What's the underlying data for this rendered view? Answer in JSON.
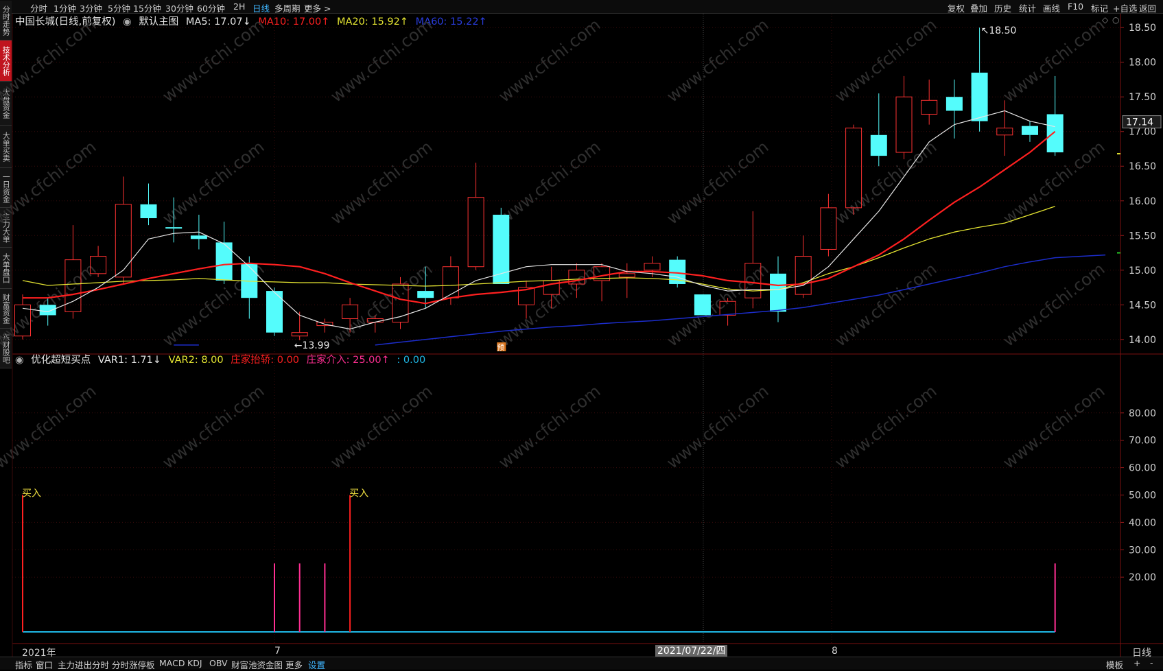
{
  "topbar": {
    "left_items": [
      "分时",
      "1分钟",
      "3分钟",
      "5分钟",
      "15分钟",
      "30分钟",
      "60分钟",
      "2H",
      "日线",
      "多周期",
      "更多 >"
    ],
    "active": "日线",
    "right_items": [
      "复权",
      "叠加",
      "历史",
      "统计",
      "画线",
      "F10",
      "标记",
      "+自选",
      "返回"
    ]
  },
  "sidebar": [
    "分时走势",
    "技术分析",
    "大盘资金",
    "大单买卖",
    "一日资金",
    "主力大单",
    "大单盘口",
    "财富资金",
    "东财股吧"
  ],
  "sidebar_active": 1,
  "main_legend": {
    "name": "中国长城(日线,前复权)",
    "template": "默认主图",
    "ma5": "MA5: 17.07↓",
    "ma10": "MA10: 17.00↑",
    "ma20": "MA20: 15.92↑",
    "ma60": "MA60: 15.22↑"
  },
  "sub_legend": {
    "name": "优化超短买点",
    "var1": "VAR1: 1.71↓",
    "var2": "VAR2: 8.00",
    "lift": "庄家抬轿: 0.00",
    "enter": "庄家介入: 25.00↑",
    "blank": ": 0.00"
  },
  "labels": {
    "high": "18.50",
    "low": "13.99",
    "current_price": "17.14",
    "pre_marker": "预",
    "buy": "买入",
    "watermark": "www.cfchi.com",
    "period": "日线"
  },
  "date_axis": {
    "year": "2021年",
    "month7": "7",
    "cursor_date": "2021/07/22/四",
    "month8": "8"
  },
  "bottombar": {
    "items": [
      "指标",
      "窗口",
      "主力进出分时",
      "分时涨停板",
      "MACD",
      "KDJ",
      "OBV",
      "财富池资金图",
      "更多",
      "设置"
    ],
    "active": "设置",
    "right_items": [
      "模板",
      "+",
      "-"
    ]
  },
  "colors": {
    "up": "#ff3232",
    "down": "#54fcfc",
    "ma5": "#e6e6e6",
    "ma10": "#ff2020",
    "ma20": "#e6e632",
    "ma60": "#1c2dcc",
    "pink": "#ff2f92",
    "cyan": "#1fb8e6",
    "yellow": "#f0e040"
  },
  "chart_data": [
    {
      "type": "candlestick",
      "title": "中国长城(日线,前复权)",
      "y_range": [
        13.8,
        18.7
      ],
      "y_ticks": [
        14.0,
        14.5,
        15.0,
        15.5,
        16.0,
        16.5,
        17.0,
        17.5,
        18.0,
        18.5
      ],
      "y_tick_labels": [
        "14.00",
        "14.50",
        "15.00",
        "15.50",
        "16.00",
        "16.50",
        "17.00",
        "17.50",
        "18.00",
        "18.50"
      ],
      "candles": [
        {
          "o": 14.05,
          "h": 14.65,
          "l": 14.0,
          "c": 14.5
        },
        {
          "o": 14.5,
          "h": 14.6,
          "l": 14.2,
          "c": 14.35
        },
        {
          "o": 14.4,
          "h": 15.65,
          "l": 14.3,
          "c": 15.15
        },
        {
          "o": 14.95,
          "h": 15.35,
          "l": 14.9,
          "c": 15.2
        },
        {
          "o": 14.9,
          "h": 16.35,
          "l": 14.8,
          "c": 15.95
        },
        {
          "o": 15.95,
          "h": 16.25,
          "l": 15.65,
          "c": 15.75
        },
        {
          "o": 15.62,
          "h": 16.05,
          "l": 15.4,
          "c": 15.6
        },
        {
          "o": 15.5,
          "h": 15.8,
          "l": 15.3,
          "c": 15.45
        },
        {
          "o": 15.4,
          "h": 15.7,
          "l": 14.8,
          "c": 14.85
        },
        {
          "o": 15.1,
          "h": 15.2,
          "l": 14.3,
          "c": 14.6
        },
        {
          "o": 14.7,
          "h": 14.75,
          "l": 14.05,
          "c": 14.1
        },
        {
          "o": 14.05,
          "h": 14.4,
          "l": 13.99,
          "c": 14.1
        },
        {
          "o": 14.2,
          "h": 14.3,
          "l": 14.1,
          "c": 14.25
        },
        {
          "o": 14.3,
          "h": 14.6,
          "l": 14.1,
          "c": 14.5
        },
        {
          "o": 14.25,
          "h": 14.35,
          "l": 14.1,
          "c": 14.3
        },
        {
          "o": 14.25,
          "h": 14.9,
          "l": 14.15,
          "c": 14.8
        },
        {
          "o": 14.7,
          "h": 15.05,
          "l": 14.45,
          "c": 14.6
        },
        {
          "o": 14.6,
          "h": 15.2,
          "l": 14.5,
          "c": 15.05
        },
        {
          "o": 15.05,
          "h": 16.55,
          "l": 15.0,
          "c": 16.05
        },
        {
          "o": 15.8,
          "h": 15.9,
          "l": 14.8,
          "c": 14.8
        },
        {
          "o": 14.5,
          "h": 14.85,
          "l": 14.3,
          "c": 14.75
        },
        {
          "o": 14.65,
          "h": 15.05,
          "l": 14.45,
          "c": 14.85
        },
        {
          "o": 14.8,
          "h": 15.1,
          "l": 14.6,
          "c": 15.0
        },
        {
          "o": 14.85,
          "h": 15.1,
          "l": 14.55,
          "c": 15.05
        },
        {
          "o": 14.9,
          "h": 15.1,
          "l": 14.6,
          "c": 14.95
        },
        {
          "o": 15.0,
          "h": 15.2,
          "l": 14.9,
          "c": 15.1
        },
        {
          "o": 15.15,
          "h": 15.2,
          "l": 14.75,
          "c": 14.8
        },
        {
          "o": 14.65,
          "h": 14.65,
          "l": 14.35,
          "c": 14.35
        },
        {
          "o": 14.35,
          "h": 14.6,
          "l": 14.2,
          "c": 14.55
        },
        {
          "o": 14.6,
          "h": 15.85,
          "l": 14.45,
          "c": 15.1
        },
        {
          "o": 14.95,
          "h": 15.2,
          "l": 14.25,
          "c": 14.4
        },
        {
          "o": 14.65,
          "h": 15.5,
          "l": 14.6,
          "c": 15.2
        },
        {
          "o": 15.3,
          "h": 16.1,
          "l": 15.2,
          "c": 15.9
        },
        {
          "o": 15.9,
          "h": 17.1,
          "l": 15.8,
          "c": 17.05
        },
        {
          "o": 16.95,
          "h": 17.55,
          "l": 16.5,
          "c": 16.65
        },
        {
          "o": 16.7,
          "h": 17.8,
          "l": 16.6,
          "c": 17.5
        },
        {
          "o": 17.25,
          "h": 17.75,
          "l": 17.1,
          "c": 17.45
        },
        {
          "o": 17.5,
          "h": 17.75,
          "l": 16.9,
          "c": 17.3
        },
        {
          "o": 17.85,
          "h": 18.5,
          "l": 17.0,
          "c": 17.15
        },
        {
          "o": 16.95,
          "h": 17.45,
          "l": 16.65,
          "c": 17.05
        },
        {
          "o": 17.08,
          "h": 17.15,
          "l": 16.85,
          "c": 16.95
        },
        {
          "o": 17.25,
          "h": 17.8,
          "l": 16.65,
          "c": 16.7
        }
      ],
      "ma5": [
        14.45,
        14.4,
        14.55,
        14.75,
        15.0,
        15.45,
        15.53,
        15.55,
        15.38,
        15.05,
        14.68,
        14.35,
        14.22,
        14.15,
        14.25,
        14.33,
        14.45,
        14.65,
        14.85,
        14.95,
        15.05,
        15.08,
        15.08,
        15.08,
        14.98,
        14.95,
        14.9,
        14.78,
        14.7,
        14.72,
        14.72,
        14.78,
        15.05,
        15.45,
        15.85,
        16.35,
        16.85,
        17.1,
        17.2,
        17.3,
        17.15,
        17.07
      ],
      "ma10": [
        14.6,
        14.6,
        14.65,
        14.72,
        14.8,
        14.88,
        14.95,
        15.02,
        15.08,
        15.1,
        15.08,
        15.05,
        14.95,
        14.82,
        14.7,
        14.58,
        14.52,
        14.6,
        14.65,
        14.68,
        14.72,
        14.8,
        14.85,
        14.92,
        14.98,
        14.98,
        14.96,
        14.92,
        14.85,
        14.82,
        14.78,
        14.8,
        14.88,
        15.05,
        15.22,
        15.45,
        15.72,
        15.98,
        16.2,
        16.45,
        16.7,
        17.0
      ],
      "ma20": [
        14.85,
        14.78,
        14.8,
        14.82,
        14.84,
        14.85,
        14.86,
        14.88,
        14.86,
        14.84,
        14.83,
        14.82,
        14.82,
        14.8,
        14.79,
        14.78,
        14.77,
        14.78,
        14.8,
        14.82,
        14.84,
        14.85,
        14.87,
        14.88,
        14.89,
        14.88,
        14.86,
        14.8,
        14.73,
        14.7,
        14.72,
        14.82,
        14.95,
        15.05,
        15.18,
        15.32,
        15.45,
        15.55,
        15.62,
        15.68,
        15.8,
        15.92
      ],
      "ma60_start_index": 6,
      "ma60": [
        13.92,
        13.92,
        null,
        null,
        null,
        null,
        null,
        null,
        13.92,
        13.96,
        14.0,
        14.04,
        14.08,
        14.12,
        14.15,
        14.18,
        14.2,
        14.23,
        14.25,
        14.27,
        14.3,
        14.33,
        14.36,
        14.39,
        14.42,
        14.46,
        14.52,
        14.58,
        14.64,
        14.72,
        14.8,
        14.88,
        14.96,
        15.05,
        15.12,
        15.18,
        15.2,
        15.22
      ]
    },
    {
      "type": "bar",
      "title": "优化超短买点",
      "y_range": [
        0,
        100
      ],
      "y_ticks": [
        20,
        30,
        40,
        50,
        60,
        70,
        80
      ],
      "y_tick_labels": [
        "20.00",
        "30.00",
        "40.00",
        "50.00",
        "60.00",
        "70.00",
        "80.00"
      ],
      "series": [
        {
          "name": "买入",
          "values": [
            {
              "i": 0,
              "v": 50
            },
            {
              "i": 13,
              "v": 50
            }
          ]
        },
        {
          "name": "庄家介入",
          "values": [
            {
              "i": 10,
              "v": 25
            },
            {
              "i": 11,
              "v": 25
            },
            {
              "i": 12,
              "v": 25
            },
            {
              "i": 41,
              "v": 25
            }
          ]
        }
      ],
      "buy_label_indices": [
        0,
        13
      ]
    }
  ]
}
